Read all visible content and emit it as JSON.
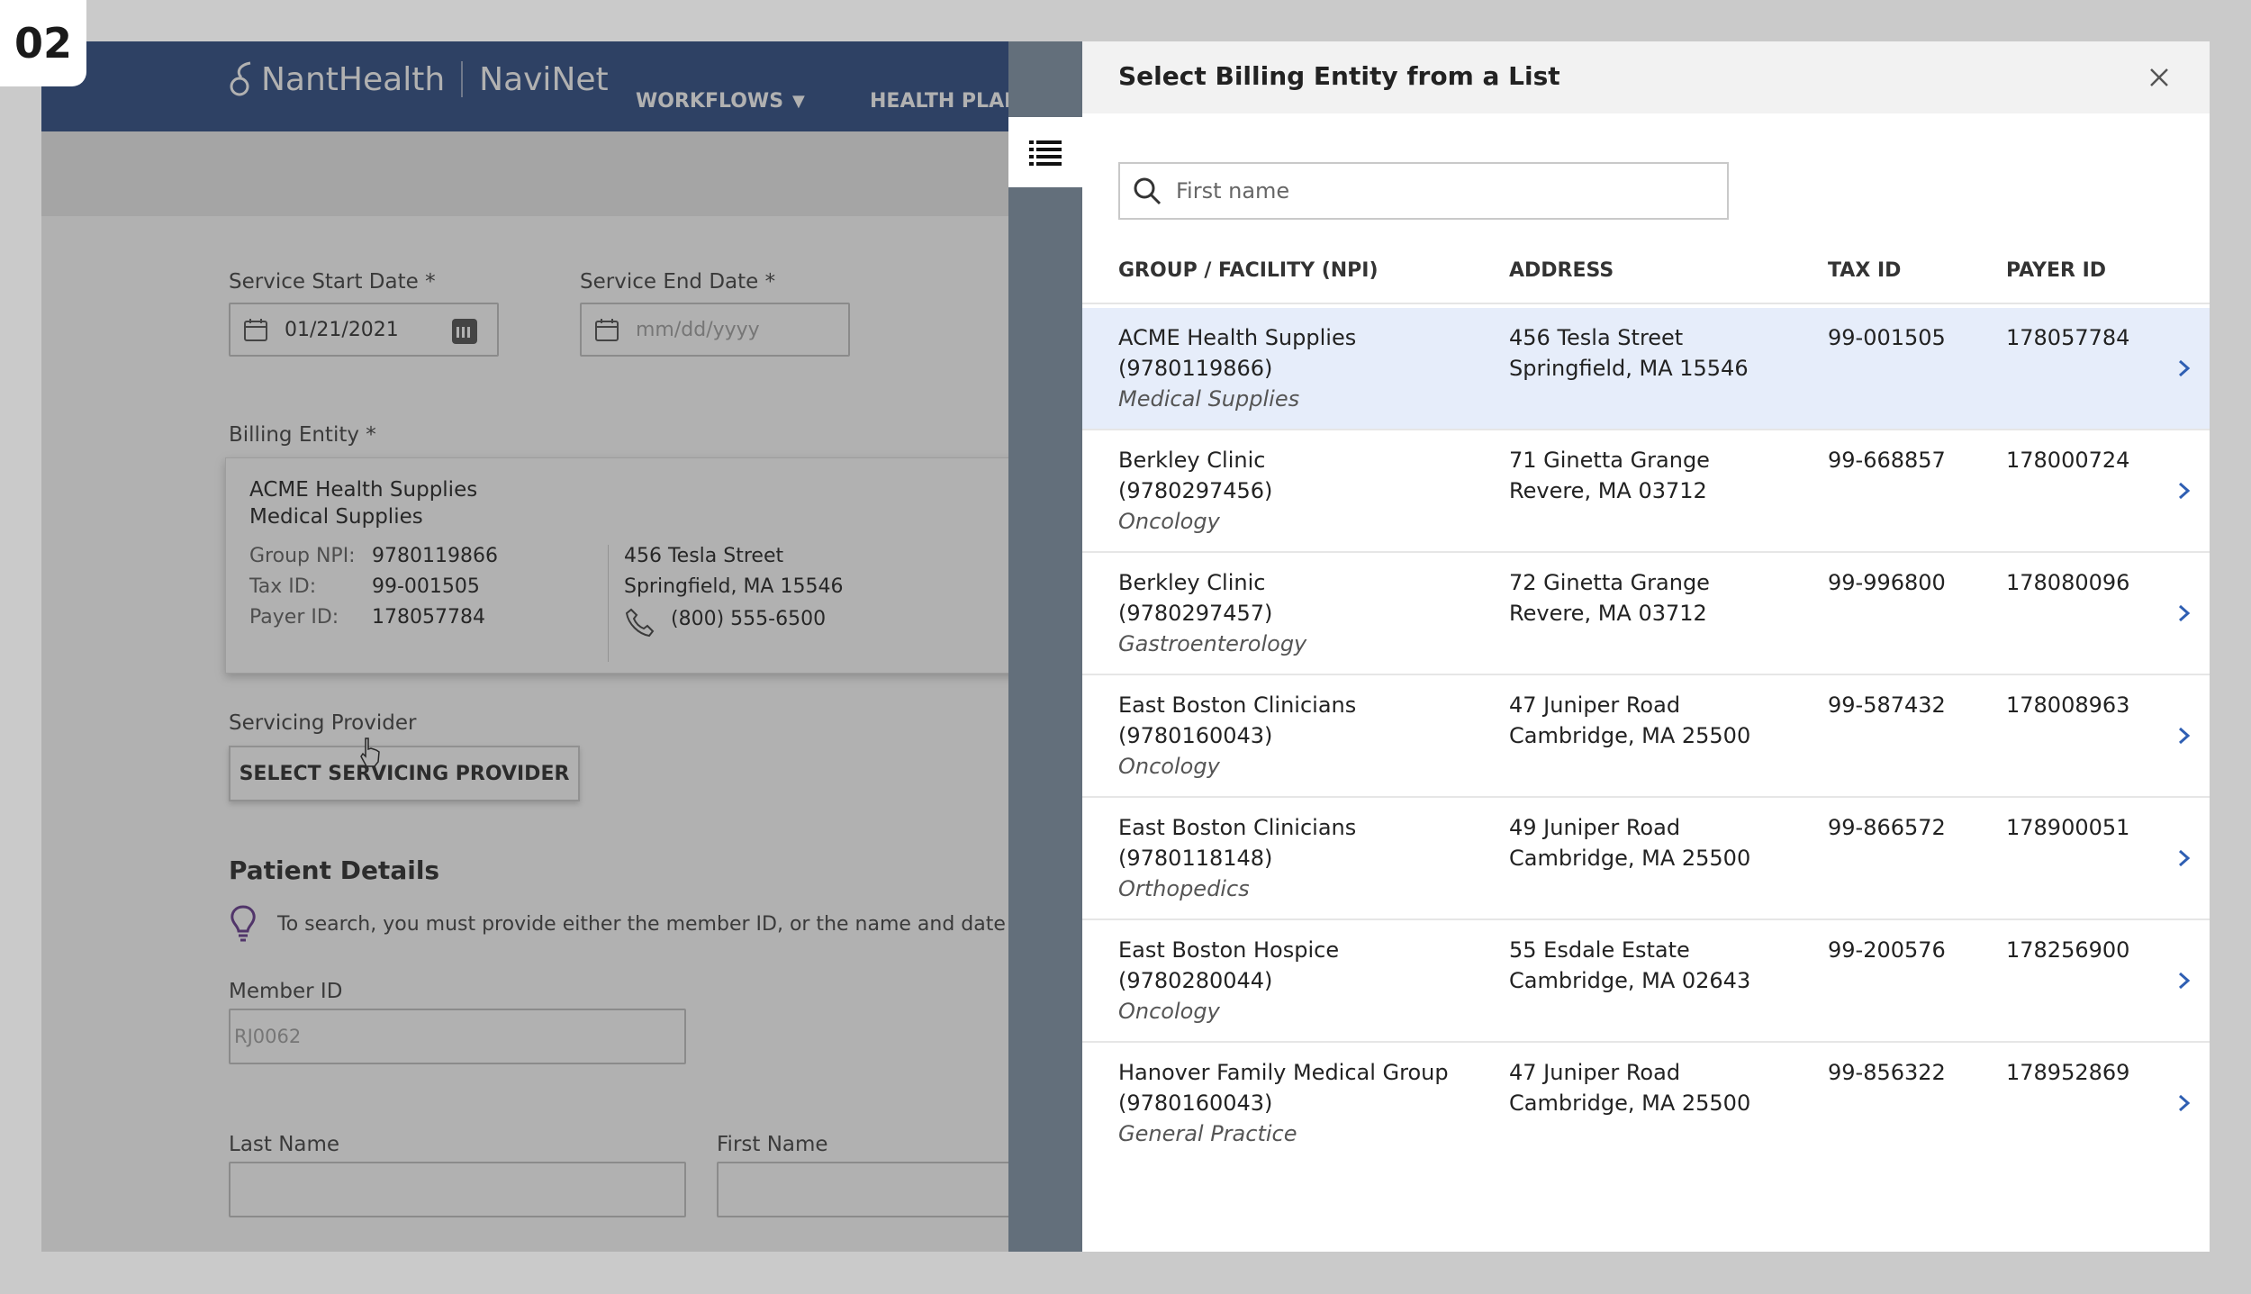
{
  "step_badge": "02",
  "app": {
    "logo_brand": "NantHealth",
    "logo_product": "NaviNet",
    "nav": {
      "workflows": "WORKFLOWS",
      "health_plans": "HEALTH PLAN"
    },
    "form": {
      "service_start_label": "Service Start Date *",
      "service_start_value": "01/21/2021",
      "service_end_label": "Service End Date *",
      "service_end_placeholder": "mm/dd/yyyy",
      "billing_label": "Billing Entity *",
      "billing": {
        "name": "ACME Health Supplies",
        "specialty": "Medical Supplies",
        "group_npi_label": "Group NPI:",
        "group_npi": "9780119866",
        "tax_id_label": "Tax ID:",
        "tax_id": "99-001505",
        "payer_id_label": "Payer ID:",
        "payer_id": "178057784",
        "street": "456 Tesla Street",
        "city": "Springfield, MA 15546",
        "phone": "(800) 555-6500"
      },
      "servicing_label": "Servicing Provider",
      "select_provider_btn": "SELECT SERVICING PROVIDER",
      "patient_title": "Patient Details",
      "patient_hint": "To search, you must provide either the member ID, or the  name and date",
      "member_id_label": "Member ID",
      "member_id_placeholder": "RJ0062",
      "last_name_label": "Last Name",
      "first_name_label": "First Name"
    }
  },
  "panel": {
    "title": "Select Billing Entity from a List",
    "search_placeholder": "First name",
    "columns": {
      "group": "GROUP / FACILITY (NPI)",
      "address": "ADDRESS",
      "tax_id": "TAX ID",
      "payer_id": "PAYER ID"
    },
    "rows": [
      {
        "name": "ACME Health Supplies",
        "npi": "(9780119866)",
        "specialty": "Medical Supplies",
        "street": "456 Tesla Street",
        "city": "Springfield, MA 15546",
        "tax_id": "99-001505",
        "payer_id": "178057784"
      },
      {
        "name": "Berkley Clinic",
        "npi": "(9780297456)",
        "specialty": "Oncology",
        "street": "71 Ginetta Grange",
        "city": "Revere, MA 03712",
        "tax_id": "99-668857",
        "payer_id": "178000724"
      },
      {
        "name": "Berkley Clinic",
        "npi": "(9780297457)",
        "specialty": "Gastroenterology",
        "street": "72 Ginetta Grange",
        "city": "Revere, MA 03712",
        "tax_id": "99-996800",
        "payer_id": "178080096"
      },
      {
        "name": "East Boston Clinicians",
        "npi": "(9780160043)",
        "specialty": "Oncology",
        "street": "47 Juniper Road",
        "city": "Cambridge, MA 25500",
        "tax_id": "99-587432",
        "payer_id": "178008963"
      },
      {
        "name": "East Boston Clinicians",
        "npi": "(9780118148)",
        "specialty": "Orthopedics",
        "street": "49 Juniper Road",
        "city": "Cambridge, MA 25500",
        "tax_id": "99-866572",
        "payer_id": "178900051"
      },
      {
        "name": "East Boston Hospice",
        "npi": "(9780280044)",
        "specialty": "Oncology",
        "street": "55 Esdale Estate",
        "city": "Cambridge, MA 02643",
        "tax_id": "99-200576",
        "payer_id": "178256900"
      },
      {
        "name": "Hanover Family Medical Group",
        "npi": "(9780160043)",
        "specialty": "General Practice",
        "street": "47 Juniper Road",
        "city": "Cambridge, MA 25500",
        "tax_id": "99-856322",
        "payer_id": "178952869"
      }
    ]
  },
  "colors": {
    "nav_blue": "#1e3f7a",
    "selected_row": "#e6edfa",
    "chevron": "#2f5fb3",
    "gutter": "#636f7b"
  }
}
